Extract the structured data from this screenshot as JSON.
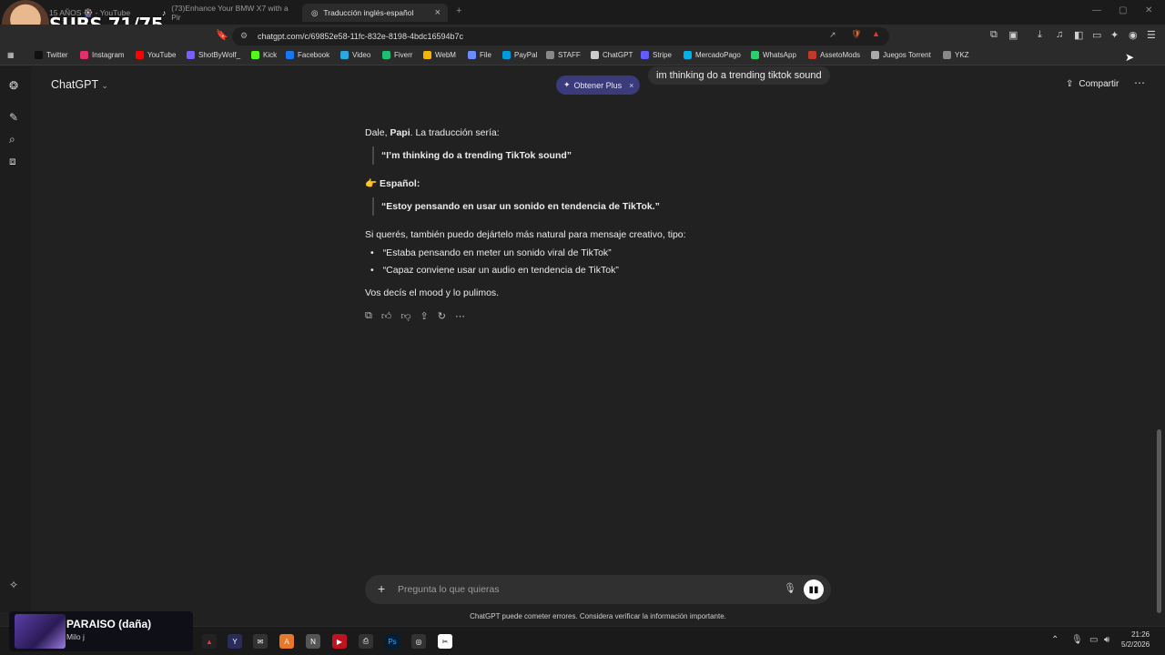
{
  "browser": {
    "tabs": [
      {
        "label": "15 AÑOS 🎡 - YouTube",
        "active": false
      },
      {
        "label": "(73)Enhance Your BMW X7 with a Pir",
        "active": false
      },
      {
        "label": "Traducción inglés-español",
        "active": true
      }
    ],
    "url": "chatgpt.com/c/69852e58-11fc-832e-8198-4bdc16594b7c",
    "bookmarks": [
      {
        "label": "Twitter",
        "color": "#111111"
      },
      {
        "label": "Instagram",
        "color": "#e1306c"
      },
      {
        "label": "YouTube",
        "color": "#ff0000"
      },
      {
        "label": "ShotByWolf_",
        "color": "#7b5cff"
      },
      {
        "label": "Kick",
        "color": "#53fc18"
      },
      {
        "label": "Facebook",
        "color": "#1877f2"
      },
      {
        "label": "Video",
        "color": "#2aa9e0"
      },
      {
        "label": "Fiverr",
        "color": "#1dbf73"
      },
      {
        "label": "WebM",
        "color": "#f4b400"
      },
      {
        "label": "File",
        "color": "#6a8cff"
      },
      {
        "label": "PayPal",
        "color": "#009cde"
      },
      {
        "label": "STAFF",
        "color": "#888888"
      },
      {
        "label": "ChatGPT",
        "color": "#cccccc"
      },
      {
        "label": "Stripe",
        "color": "#635bff"
      },
      {
        "label": "MercadoPago",
        "color": "#00b1ea"
      },
      {
        "label": "WhatsApp",
        "color": "#25d366"
      },
      {
        "label": "AssetoMods",
        "color": "#c0392b"
      },
      {
        "label": "Juegos Torrent",
        "color": "#aaaaaa"
      },
      {
        "label": "YKZ",
        "color": "#888888"
      }
    ]
  },
  "overlay": {
    "subs_text": "SUBS 71/75",
    "song": "PARAISO (daña)",
    "artist": "Milo j"
  },
  "chat": {
    "title": "ChatGPT",
    "plus_label": "Obtener Plus",
    "share_label": "Compartir",
    "user_message": "im thinking do a trending tiktok sound",
    "intro_prefix": "Dale, ",
    "intro_bold": "Papi",
    "intro_suffix": ". La traducción sería:",
    "quote_en": "“I’m thinking do a trending TikTok sound”",
    "spanish_heading": "👉 Español:",
    "quote_es": "“Estoy pensando en usar un sonido en tendencia de TikTok.”",
    "suggestion_intro": "Si querés, también puedo dejártelo más natural para mensaje creativo, tipo:",
    "bullets": [
      "“Estaba pensando en meter un sonido viral de TikTok”",
      "“Capaz conviene usar un audio en tendencia de TikTok”"
    ],
    "closing": "Vos decís el mood y lo pulimos.",
    "composer_placeholder": "Pregunta lo que quieras",
    "disclaimer": "ChatGPT puede cometer errores. Considera verificar la información importante."
  },
  "system": {
    "time": "21:26",
    "date": "5/2/2026"
  }
}
